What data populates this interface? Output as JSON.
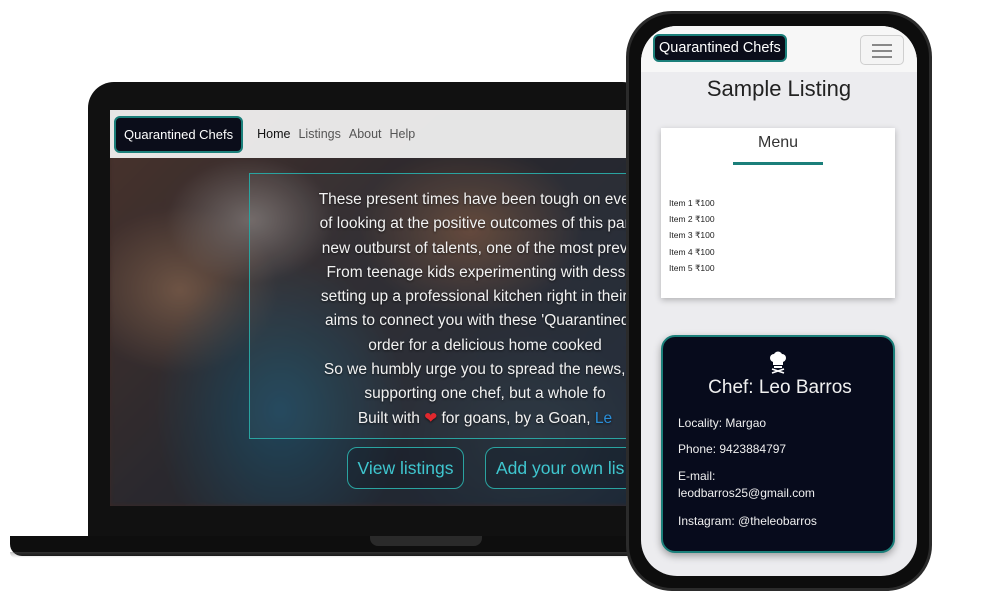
{
  "laptop": {
    "brand": "Quarantined Chefs",
    "nav": [
      "Home",
      "Listings",
      "About",
      "Help"
    ],
    "hero_lines": [
      "These present times have been tough on everyo",
      "of looking at the positive outcomes of this pande",
      "new outburst of talents, one of the most prevale",
      "From teenage kids experimenting with dessert",
      "setting up a professional kitchen right in their ho",
      "aims to connect you with these 'Quarantined C",
      "order for a delicious home cooked",
      "So we humbly urge you to spread the news, as",
      "supporting one chef, but a whole fo"
    ],
    "built_with_prefix": "Built with",
    "built_with_suffix": "for goans, by a Goan,",
    "author_link": "Le",
    "view_listings_label": "View listings",
    "add_listing_label": "Add your own lis"
  },
  "phone": {
    "brand": "Quarantined Chefs",
    "page_title": "Sample Listing",
    "menu_heading": "Menu",
    "menu_items": [
      "Item 1 ₹100",
      "Item 2 ₹100",
      "Item 3 ₹100",
      "Item 4 ₹100",
      "Item 5 ₹100"
    ],
    "chef_name": "Chef: Leo Barros",
    "locality": "Locality: Margao",
    "phone": "Phone: 9423884797",
    "email_label": "E-mail:",
    "email": "leodbarros25@gmail.com",
    "instagram": "Instagram: @theleobarros"
  },
  "icons": {
    "heart": "heart-icon",
    "chef": "chef-hat-icon",
    "menu": "hamburger-icon"
  },
  "colors": {
    "brand_bg": "#0b0d1a",
    "accent_teal": "#1b7f7a",
    "button_text": "#3fc6cf",
    "heart": "#e0282e",
    "link": "#2a8ed8"
  }
}
